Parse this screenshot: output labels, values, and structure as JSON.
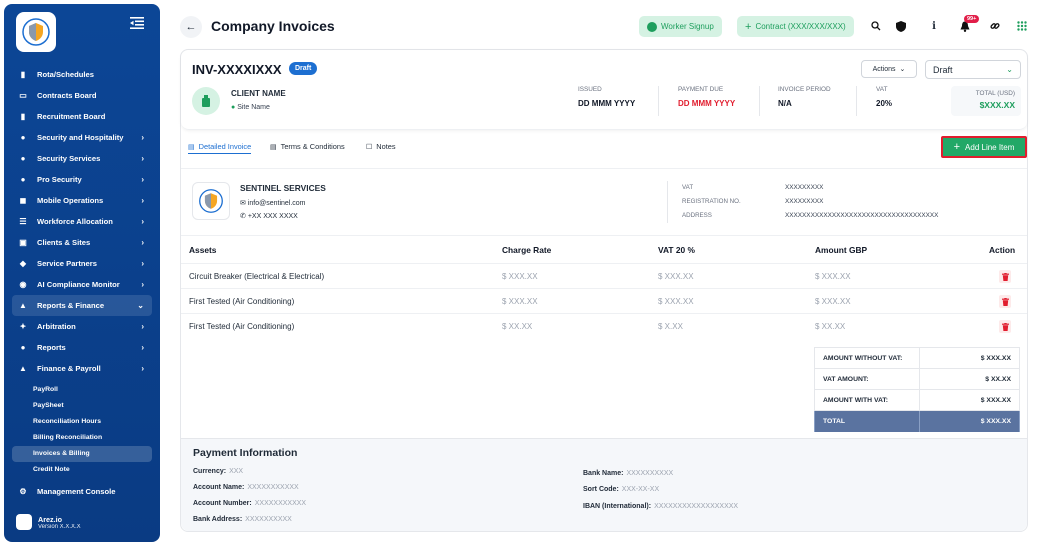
{
  "sidebar": {
    "items": [
      {
        "label": "Rota/Schedules",
        "icon": "clipboard-icon",
        "chevron": false
      },
      {
        "label": "Contracts Board",
        "icon": "contract-icon",
        "chevron": false
      },
      {
        "label": "Recruitment Board",
        "icon": "briefcase-icon",
        "chevron": false
      },
      {
        "label": "Security and Hospitality",
        "icon": "person-icon",
        "chevron": true
      },
      {
        "label": "Security Services",
        "icon": "person-icon",
        "chevron": true
      },
      {
        "label": "Pro Security",
        "icon": "person-icon",
        "chevron": true
      },
      {
        "label": "Mobile Operations",
        "icon": "car-icon",
        "chevron": true
      },
      {
        "label": "Workforce Allocation",
        "icon": "list-icon",
        "chevron": true
      },
      {
        "label": "Clients & Sites",
        "icon": "building-icon",
        "chevron": true
      },
      {
        "label": "Service Partners",
        "icon": "handshake-icon",
        "chevron": true
      },
      {
        "label": "AI Compliance Monitor",
        "icon": "robot-icon",
        "chevron": true
      },
      {
        "label": "Reports & Finance",
        "icon": "chart-icon",
        "chevron": true,
        "expanded": true
      },
      {
        "label": "Arbitration",
        "icon": "gavel-icon",
        "chevron": true
      },
      {
        "label": "Reports",
        "icon": "people-icon",
        "chevron": true
      },
      {
        "label": "Finance & Payroll",
        "icon": "chart-icon",
        "chevron": true
      }
    ],
    "sub_items": [
      "PayRoll",
      "PaySheet",
      "Reconciliation Hours",
      "Billing Reconciliation",
      "Invoices & Billing",
      "Credit Note"
    ],
    "active_sub": "Invoices & Billing",
    "management": "Management Console",
    "user": {
      "name": "Arez.io",
      "version": "Version X.X.X.X"
    }
  },
  "header": {
    "title": "Company Invoices",
    "worker_signup": "Worker Signup",
    "contract": "Contract (XXX/XXX/XXX)",
    "notif_count": "99+"
  },
  "invoice": {
    "number": "INV-XXXXIXXX",
    "status_badge": "Draft",
    "actions_label": "Actions",
    "status_select": "Draft",
    "client_name": "CLIENT NAME",
    "site_name": "Site Name",
    "meta": [
      {
        "label": "ISSUED",
        "value": "DD MMM YYYY",
        "color": "#111827"
      },
      {
        "label": "PAYMENT DUE",
        "value": "DD MMM YYYY",
        "color": "#e11d2e"
      },
      {
        "label": "INVOICE PERIOD",
        "value": "N/A",
        "color": "#111827"
      },
      {
        "label": "VAT",
        "value": "20%",
        "color": "#111827"
      }
    ],
    "total_label": "TOTAL (USD)",
    "total_value": "$XXX.XX"
  },
  "tabs": [
    {
      "label": "Detailed Invoice",
      "active": true
    },
    {
      "label": "Terms & Conditions",
      "active": false
    },
    {
      "label": "Notes",
      "active": false
    }
  ],
  "add_line_item": "Add Line Item",
  "company": {
    "name": "SENTINEL SERVICES",
    "email": "info@sentinel.com",
    "phone": "+XX XXX XXXX",
    "vat_label": "VAT",
    "vat_value": "XXXXXXXXX",
    "reg_label": "REGISTRATION NO.",
    "reg_value": "XXXXXXXXX",
    "address_label": "ADDRESS",
    "address_value": "XXXXXXXXXXXXXXXXXXXXXXXXXXXXXXXXXXXX"
  },
  "table": {
    "headers": [
      "Assets",
      "Charge Rate",
      "VAT 20 %",
      "Amount GBP",
      "Action"
    ],
    "rows": [
      [
        "Circuit Breaker (Electrical & Electrical)",
        "$ XXX.XX",
        "$ XXX.XX",
        "$ XXX.XX"
      ],
      [
        "First Tested (Air Conditioning)",
        "$ XXX.XX",
        "$ XXX.XX",
        "$ XXX.XX"
      ],
      [
        "First Tested (Air Conditioning)",
        "$ XX.XX",
        "$ X.XX",
        "$ XX.XX"
      ]
    ]
  },
  "summary": [
    {
      "label": "AMOUNT WITHOUT VAT:",
      "value": "$ XXX.XX"
    },
    {
      "label": "VAT AMOUNT:",
      "value": "$ XX.XX"
    },
    {
      "label": "AMOUNT WITH VAT:",
      "value": "$ XXX.XX"
    },
    {
      "label": "TOTAL",
      "value": "$ XXX.XX"
    }
  ],
  "payment": {
    "title": "Payment Information",
    "left": [
      {
        "label": "Currency:",
        "value": "XXX"
      },
      {
        "label": "Account Name:",
        "value": "XXXXXXXXXXX"
      },
      {
        "label": "Account Number:",
        "value": "XXXXXXXXXXX"
      },
      {
        "label": "Bank Address:",
        "value": "XXXXXXXXXX"
      }
    ],
    "right": [
      {
        "label": "Bank Name:",
        "value": "XXXXXXXXXX"
      },
      {
        "label": "Sort Code:",
        "value": "XXX-XX-XX"
      },
      {
        "label": "IBAN (International):",
        "value": "XXXXXXXXXXXXXXXXXX"
      }
    ]
  },
  "colors": {
    "accent": "#1d6fd1",
    "brand_green": "#22a867",
    "sidebar": "#0c4696",
    "danger": "#e11d2e"
  }
}
